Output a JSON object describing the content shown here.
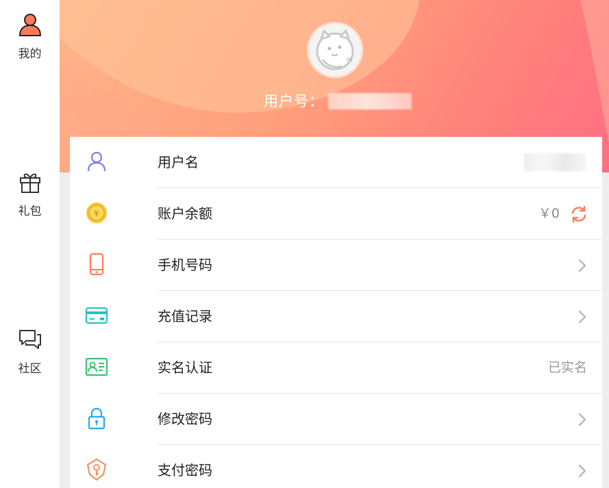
{
  "sidebar": {
    "items": [
      {
        "label": "我的",
        "icon": "user-icon"
      },
      {
        "label": "礼包",
        "icon": "gift-icon"
      },
      {
        "label": "社区",
        "icon": "chat-icon"
      }
    ]
  },
  "header": {
    "uid_label": "用户号："
  },
  "rows": [
    {
      "label": "用户名",
      "icon": "user-outline-icon"
    },
    {
      "label": "账户余额",
      "icon": "coin-icon",
      "value": "￥0"
    },
    {
      "label": "手机号码",
      "icon": "phone-icon"
    },
    {
      "label": "充值记录",
      "icon": "card-icon"
    },
    {
      "label": "实名认证",
      "icon": "id-card-icon",
      "value": "已实名"
    },
    {
      "label": "修改密码",
      "icon": "lock-icon"
    },
    {
      "label": "支付密码",
      "icon": "shield-key-icon"
    }
  ],
  "colors": {
    "accent": "#ff7f5c",
    "banner_start": "#ffb489",
    "banner_end": "#ff6f84"
  }
}
